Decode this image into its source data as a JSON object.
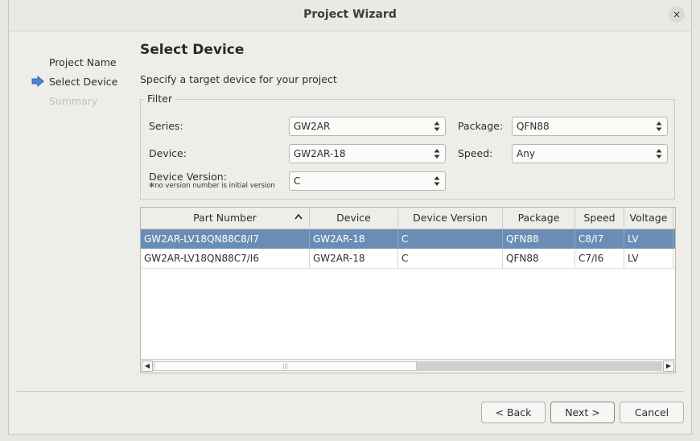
{
  "window": {
    "title": "Project Wizard",
    "close_icon": "×"
  },
  "steps": [
    {
      "label": "Project Name",
      "state": "done"
    },
    {
      "label": "Select Device",
      "state": "current"
    },
    {
      "label": "Summary",
      "state": "pending"
    }
  ],
  "page": {
    "heading": "Select Device",
    "subtitle": "Specify a target device for your project"
  },
  "filter": {
    "legend": "Filter",
    "series_label": "Series:",
    "series_value": "GW2AR",
    "package_label": "Package:",
    "package_value": "QFN88",
    "device_label": "Device:",
    "device_value": "GW2AR-18",
    "speed_label": "Speed:",
    "speed_value": "Any",
    "version_label": "Device Version:",
    "version_note": "✻no version number is initial version",
    "version_value": "C"
  },
  "table": {
    "columns": [
      "Part Number",
      "Device",
      "Device Version",
      "Package",
      "Speed",
      "Voltage"
    ],
    "rows": [
      [
        "GW2AR-LV18QN88C8/I7",
        "GW2AR-18",
        "C",
        "QFN88",
        "C8/I7",
        "LV"
      ],
      [
        "GW2AR-LV18QN88C7/I6",
        "GW2AR-18",
        "C",
        "QFN88",
        "C7/I6",
        "LV"
      ]
    ],
    "selected_row": 0,
    "sort_column": "Part Number",
    "sort_direction": "ascending"
  },
  "buttons": {
    "back": "< Back",
    "next": "Next >",
    "cancel": "Cancel"
  },
  "colors": {
    "selection": "#6a8db5",
    "window_bg": "#efedea",
    "step_arrow": "#4a86d0"
  }
}
